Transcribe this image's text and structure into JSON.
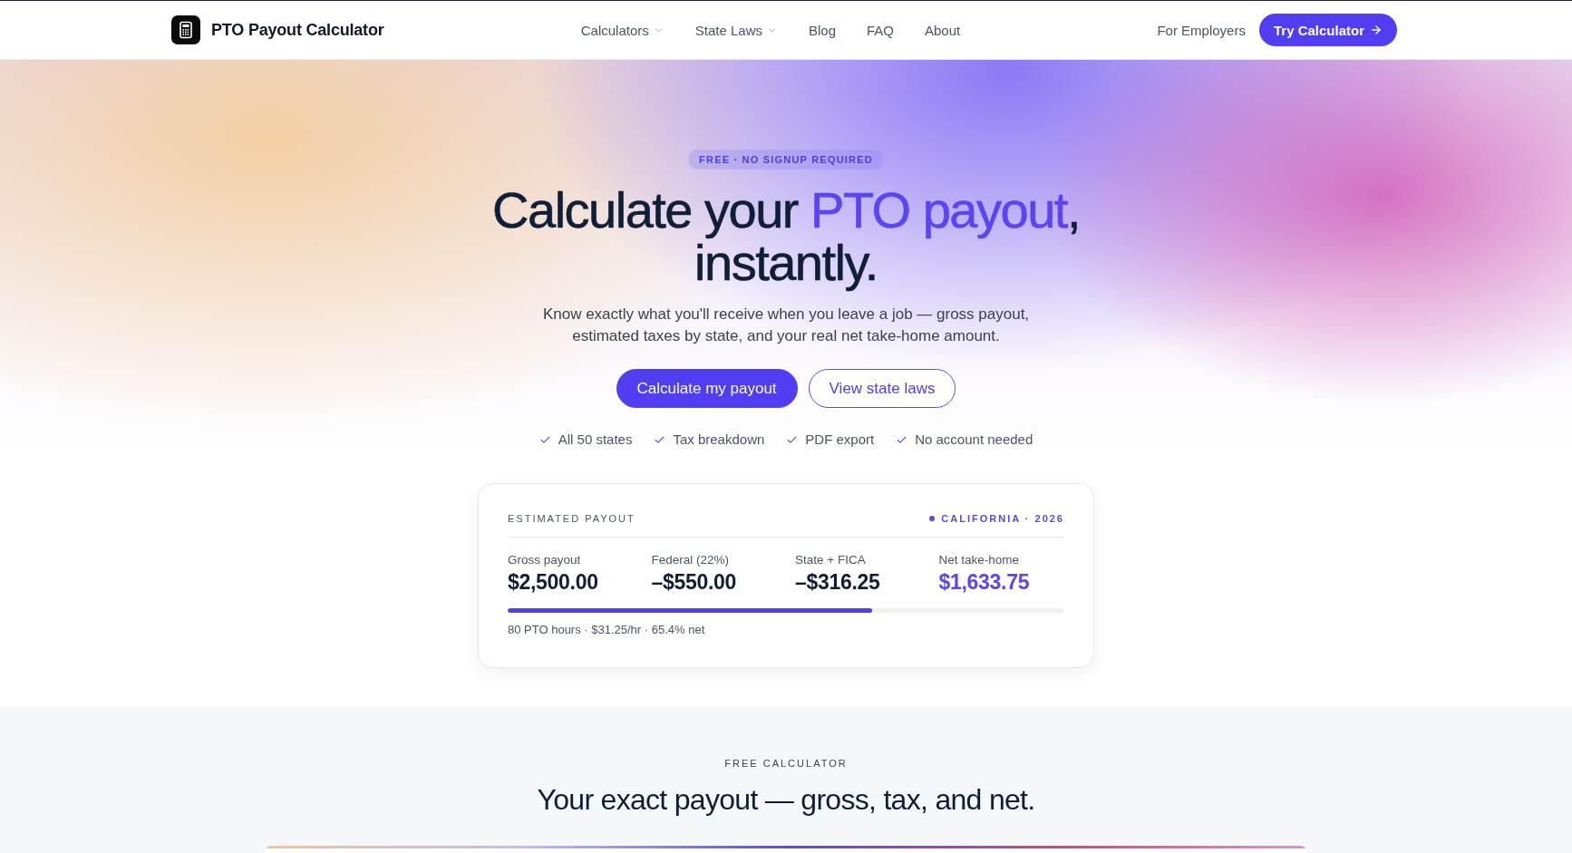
{
  "header": {
    "brand": "PTO Payout Calculator",
    "nav": [
      {
        "label": "Calculators",
        "kind": "dropdown"
      },
      {
        "label": "State Laws",
        "kind": "dropdown"
      },
      {
        "label": "Blog",
        "kind": "link"
      },
      {
        "label": "FAQ",
        "kind": "link"
      },
      {
        "label": "About",
        "kind": "link"
      }
    ],
    "employer_link": "For Employers",
    "cta": "Try Calculator"
  },
  "hero": {
    "badge": "FREE · NO SIGNUP REQUIRED",
    "headline": {
      "text_before": "Calculate your ",
      "highlight": "PTO payout",
      "text_after": ",",
      "second_line": "instantly."
    },
    "subtitle": "Know exactly what you'll receive when you leave a job — gross payout, estimated taxes by state, and your real net take-home amount.",
    "buttons": [
      {
        "label": "Calculate my payout",
        "kind": "primary"
      },
      {
        "label": "View state laws",
        "kind": "secondary"
      }
    ],
    "features": [
      "All 50 states",
      "Tax breakdown",
      "PDF export",
      "No account needed"
    ]
  },
  "payout_card": {
    "title": "ESTIMATED PAYOUT",
    "region": "CALIFORNIA · 2026",
    "stats": [
      {
        "label": "Gross payout",
        "value": "$2,500.00",
        "highlighted": false
      },
      {
        "label": "Federal (22%)",
        "value": "–$550.00",
        "highlighted": false
      },
      {
        "label": "State + FICA",
        "value": "–$316.25",
        "highlighted": false
      },
      {
        "label": "Net take-home",
        "value": "$1,633.75",
        "highlighted": true
      }
    ],
    "progress": {
      "level": 0.654
    },
    "summary": "80 PTO hours · $31.25/hr · 65.4% net"
  },
  "calculator_section": {
    "eyebrow": "FREE CALCULATOR",
    "title": "Your exact payout — gross, tax, and net."
  }
}
